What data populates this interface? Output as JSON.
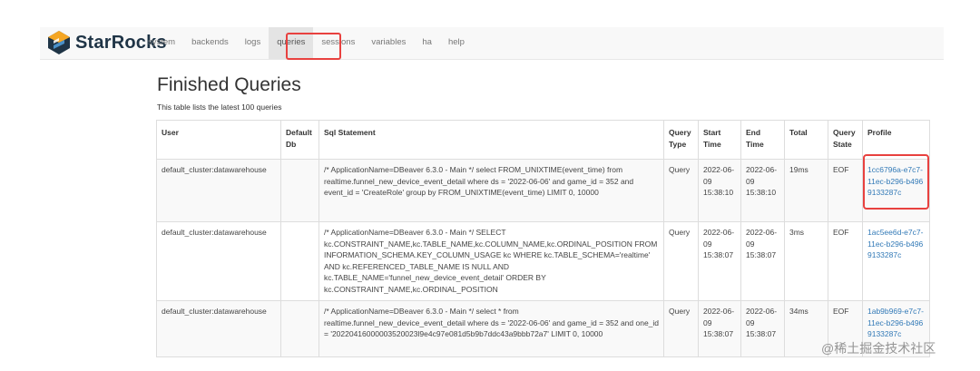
{
  "brand": {
    "name": "StarRocks"
  },
  "nav": {
    "items": [
      {
        "label": "system"
      },
      {
        "label": "backends"
      },
      {
        "label": "logs"
      },
      {
        "label": "queries"
      },
      {
        "label": "sessions"
      },
      {
        "label": "variables"
      },
      {
        "label": "ha"
      },
      {
        "label": "help"
      }
    ],
    "active": "queries"
  },
  "page": {
    "title": "Finished Queries",
    "subtitle": "This table lists the latest 100 queries"
  },
  "table": {
    "headers": [
      "User",
      "Default Db",
      "Sql Statement",
      "Query Type",
      "Start Time",
      "End Time",
      "Total",
      "Query State",
      "Profile"
    ],
    "rows": [
      {
        "user": "default_cluster:datawarehouse",
        "default_db": "",
        "sql": "/* ApplicationName=DBeaver 6.3.0 - Main */ select FROM_UNIXTIME(event_time) from realtime.funnel_new_device_event_detail where ds = '2022-06-06' and game_id = 352 and event_id = 'CreateRole' group by FROM_UNIXTIME(event_time) LIMIT 0, 10000",
        "query_type": "Query",
        "start_time": "2022-06-09 15:38:10",
        "end_time": "2022-06-09 15:38:10",
        "total": "19ms",
        "state": "EOF",
        "profile": "1cc6796a-e7c7-11ec-b296-b4969133287c"
      },
      {
        "user": "default_cluster:datawarehouse",
        "default_db": "",
        "sql": "/* ApplicationName=DBeaver 6.3.0 - Main */ SELECT kc.CONSTRAINT_NAME,kc.TABLE_NAME,kc.COLUMN_NAME,kc.ORDINAL_POSITION FROM INFORMATION_SCHEMA.KEY_COLUMN_USAGE kc WHERE kc.TABLE_SCHEMA='realtime' AND kc.REFERENCED_TABLE_NAME IS NULL AND kc.TABLE_NAME='funnel_new_device_event_detail' ORDER BY kc.CONSTRAINT_NAME,kc.ORDINAL_POSITION",
        "query_type": "Query",
        "start_time": "2022-06-09 15:38:07",
        "end_time": "2022-06-09 15:38:07",
        "total": "3ms",
        "state": "EOF",
        "profile": "1ac5ee6d-e7c7-11ec-b296-b4969133287c"
      },
      {
        "user": "default_cluster:datawarehouse",
        "default_db": "",
        "sql": "/* ApplicationName=DBeaver 6.3.0 - Main */ select * from realtime.funnel_new_device_event_detail where ds = '2022-06-06' and game_id = 352 and one_id = '20220416000003520023l9e4c97e081d5b9b7ddc43a9bbb72a7' LIMIT 0, 10000",
        "query_type": "Query",
        "start_time": "2022-06-09 15:38:07",
        "end_time": "2022-06-09 15:38:07",
        "total": "34ms",
        "state": "EOF",
        "profile": "1ab9b969-e7c7-11ec-b296-b4969133287c"
      }
    ]
  },
  "watermark": "@稀土掘金技术社区",
  "colors": {
    "accent_link": "#337ab7",
    "highlight": "#e8413f",
    "brand": "#1f3446"
  }
}
